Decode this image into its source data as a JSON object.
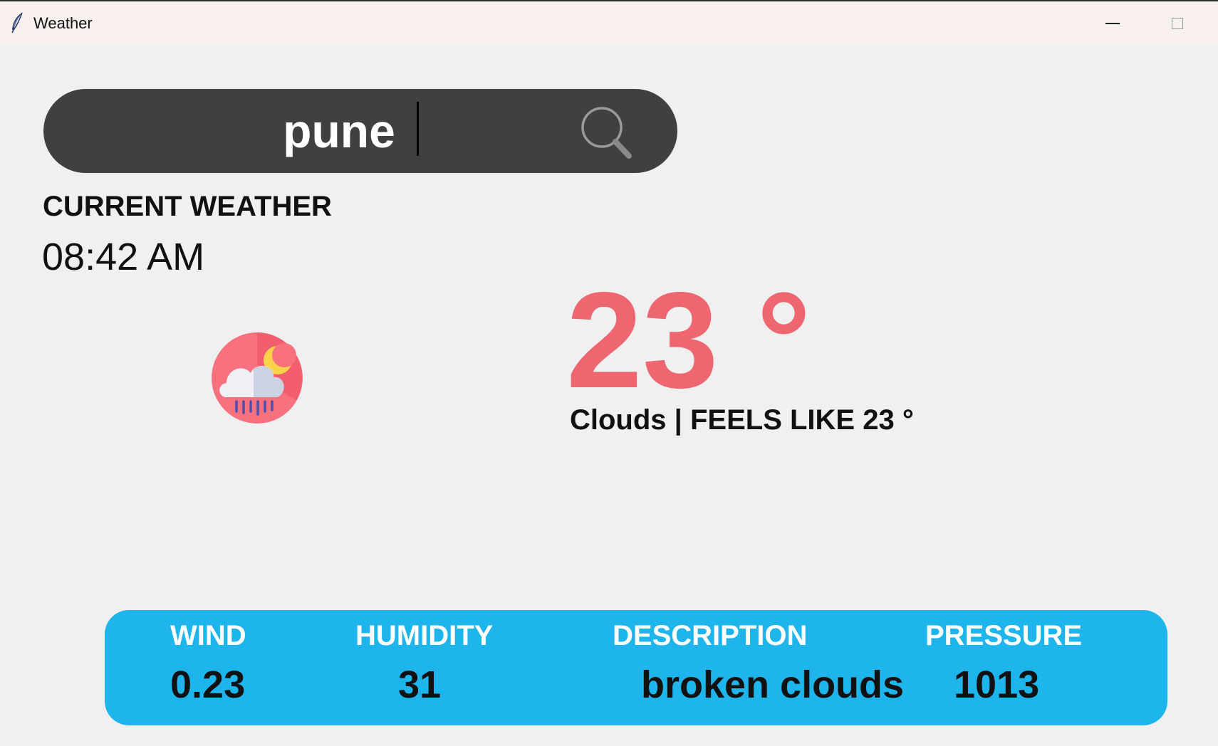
{
  "window": {
    "title": "Weather",
    "icon": "feather-icon"
  },
  "search": {
    "value": "pune",
    "icon": "search-icon"
  },
  "current": {
    "heading": "CURRENT WEATHER",
    "time": "08:42 AM",
    "icon": "cloud-moon-rain-icon",
    "temperature": "23 °",
    "condition": "Clouds | FEELS LIKE 23 °"
  },
  "details": {
    "wind_label": "WIND",
    "wind_value": "0.23",
    "humidity_label": "HUMIDITY",
    "humidity_value": "31",
    "description_label": "DESCRIPTION",
    "description_value": "broken clouds",
    "pressure_label": "PRESSURE",
    "pressure_value": "1013"
  },
  "colors": {
    "search_bar": "#404040",
    "temperature": "#ee6670",
    "panel": "#1eb5ec",
    "background": "#f0f0f0"
  }
}
